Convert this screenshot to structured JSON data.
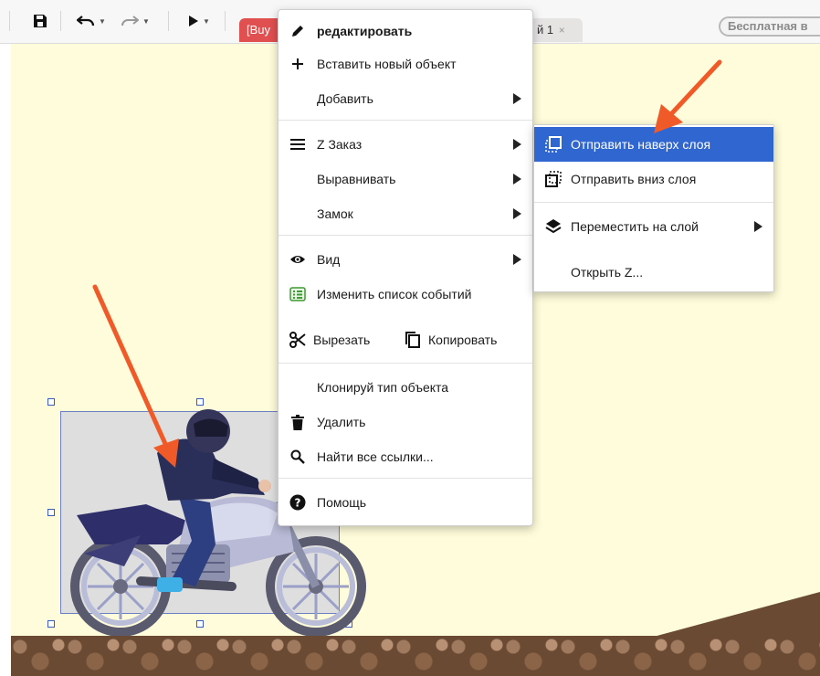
{
  "toolbar": {
    "active_tab": "[Buy",
    "inactive_tab": "й 1",
    "tab_close": "×",
    "free_badge": "Бесплатная в"
  },
  "menu": {
    "items": [
      {
        "label": "редактировать",
        "icon": "pencil-icon",
        "bold": true
      },
      {
        "label": "Вставить новый объект",
        "icon": "plus-icon"
      },
      {
        "label": "Добавить",
        "has_submenu": true
      },
      {
        "label": "Z Заказ",
        "icon": "list-icon",
        "has_submenu": true
      },
      {
        "label": "Выравнивать",
        "has_submenu": true
      },
      {
        "label": "Замок",
        "has_submenu": true
      },
      {
        "label": "Вид",
        "icon": "eye-icon",
        "has_submenu": true
      },
      {
        "label": "Изменить список событий",
        "icon": "event-sheet-icon"
      },
      {
        "label": "Вырезать",
        "icon": "scissors-icon"
      },
      {
        "label": "Копировать",
        "icon": "copy-icon"
      },
      {
        "label": "Клонируй тип объекта"
      },
      {
        "label": "Удалить",
        "icon": "trash-icon"
      },
      {
        "label": "Найти все ссылки...",
        "icon": "search-icon"
      },
      {
        "label": "Помощь",
        "icon": "help-icon"
      }
    ]
  },
  "submenu": {
    "items": [
      {
        "label": "Отправить наверх слоя",
        "icon": "bring-to-top-icon",
        "highlighted": true
      },
      {
        "label": "Отправить вниз слоя",
        "icon": "send-to-bottom-icon"
      },
      {
        "label": "Переместить на слой",
        "icon": "layers-icon",
        "has_submenu": true
      },
      {
        "label": "Открыть Z..."
      }
    ]
  },
  "colors": {
    "canvas": "#fefcda",
    "highlight": "#2f66d0",
    "annotation_arrow": "#f05a28",
    "active_tab": "#e05050"
  }
}
